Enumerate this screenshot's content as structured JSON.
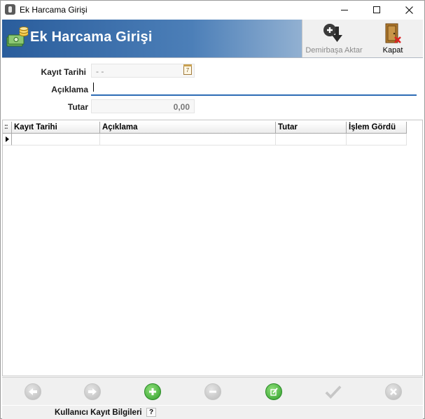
{
  "window": {
    "title": "Ek Harcama Girişi"
  },
  "banner": {
    "title": "Ek Harcama Girişi",
    "demirbas_label": "Demirbaşa Aktar",
    "kapat_label": "Kapat"
  },
  "form": {
    "kayit_tarihi_label": "Kayıt Tarihi",
    "kayit_tarihi_value": "- -",
    "aciklama_label": "Açıklama",
    "aciklama_value": "",
    "tutar_label": "Tutar",
    "tutar_value": "0,00",
    "calendar_glyph": "7"
  },
  "grid": {
    "corner": "::",
    "columns": [
      "Kayıt Tarihi",
      "Açıklama",
      "Tutar",
      "İşlem Gördü"
    ],
    "rows": [
      [
        "",
        "",
        "",
        ""
      ]
    ]
  },
  "navigator": {
    "buttons": [
      "prev-icon",
      "next-icon",
      "add-icon",
      "delete-icon",
      "edit-icon",
      "confirm-icon",
      "cancel-icon"
    ]
  },
  "footer": {
    "label": "Kullanıcı Kayıt Bilgileri",
    "help": "?"
  },
  "colors": {
    "banner_start": "#2a5d9c",
    "banner_end": "#c9d7e6",
    "active_underline": "#2d6cb5",
    "green": "#2f9d2a"
  }
}
